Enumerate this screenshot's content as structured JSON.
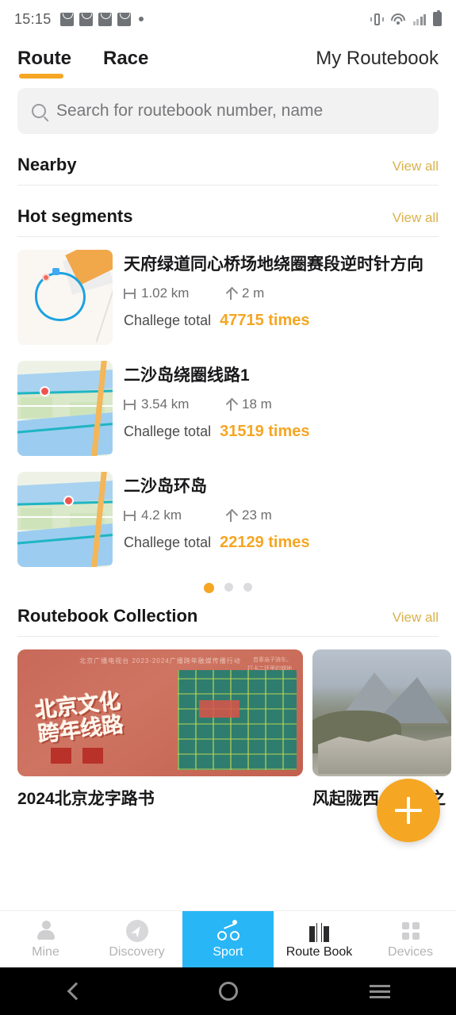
{
  "status_bar": {
    "time": "15:15",
    "left_icons": [
      "mail-icon",
      "mail-icon",
      "mail-icon",
      "mail-icon",
      "dot-icon"
    ],
    "right_icons": [
      "vibrate-icon",
      "wifi-icon",
      "signal-icon",
      "battery-icon"
    ]
  },
  "header": {
    "tabs": [
      {
        "label": "Route",
        "active": true
      },
      {
        "label": "Race",
        "active": false
      }
    ],
    "my_routebook": "My Routebook"
  },
  "search": {
    "placeholder": "Search for routebook number, name",
    "value": "",
    "icon": "search-icon"
  },
  "sections": {
    "nearby": {
      "title": "Nearby",
      "view_all": "View all"
    },
    "hot_segments": {
      "title": "Hot segments",
      "view_all": "View all"
    },
    "routebook_collection": {
      "title": "Routebook Collection",
      "view_all": "View all"
    }
  },
  "hot_segments": {
    "challenge_label": "Challege total",
    "items": [
      {
        "name": "天府绿道同心桥场地绕圈赛段逆时针方向",
        "distance": "1.02 km",
        "elevation": "2 m",
        "challenges": "47715 times",
        "thumb": "map-loop-thumbnail"
      },
      {
        "name": "二沙岛绕圈线路1",
        "distance": "3.54 km",
        "elevation": "18 m",
        "challenges": "31519 times",
        "thumb": "map-island-thumbnail"
      },
      {
        "name": "二沙岛环岛",
        "distance": "4.2 km",
        "elevation": "23 m",
        "challenges": "22129 times",
        "thumb": "map-island-thumbnail"
      }
    ],
    "pagination": {
      "total": 3,
      "active": 0
    }
  },
  "collection": {
    "cards": [
      {
        "caption": "2024北京龙字路书",
        "image": "beijing-poster-image"
      },
      {
        "caption": "风起陇西（洛克之",
        "image": "mountain-landscape-image"
      }
    ]
  },
  "fab": {
    "label": "+",
    "icon": "plus-icon",
    "color": "#f5a623"
  },
  "bottom_nav": {
    "items": [
      {
        "label": "Mine",
        "icon": "person-icon",
        "state": "inactive"
      },
      {
        "label": "Discovery",
        "icon": "compass-icon",
        "state": "inactive"
      },
      {
        "label": "Sport",
        "icon": "cyclist-icon",
        "state": "selected"
      },
      {
        "label": "Route Book",
        "icon": "map-book-icon",
        "state": "active"
      },
      {
        "label": "Devices",
        "icon": "grid-icon",
        "state": "inactive"
      }
    ]
  },
  "system_nav": {
    "back": "back-icon",
    "home": "home-icon",
    "recents": "recents-icon"
  },
  "theme": {
    "accent_orange": "#f5a623",
    "view_all_gold": "#d9b24c",
    "sport_blue": "#29b6f6",
    "text_primary": "#18181a"
  }
}
